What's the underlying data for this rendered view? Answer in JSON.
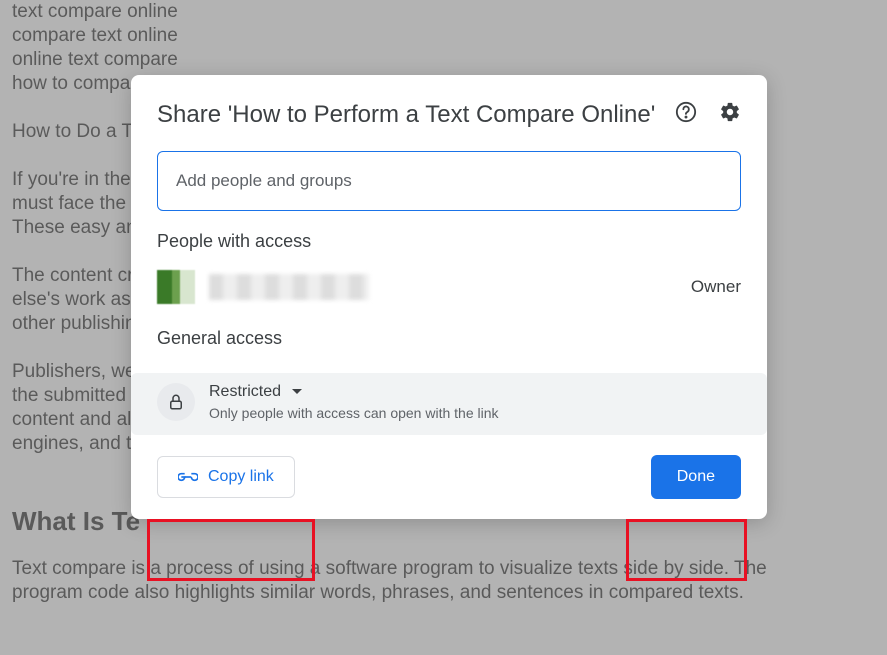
{
  "document": {
    "lines": [
      "text compare online",
      "compare text online",
      "online text compare",
      "how to compa"
    ],
    "para2": "How to Do a T",
    "para3": "If you're in the",
    "para3b": "must face the ",
    "para3c": "These easy an",
    "para4": "The content cr",
    "para4b": "else's work as",
    "para4c": "other publishin",
    "para5": "Publishers, we",
    "para5b": "the submitted ",
    "para5c": "content and al",
    "para5d": "engines, and t",
    "heading": "What Is Te",
    "para6": "Text compare is a process of using a software program to visualize texts side by side. The",
    "para6b": "program code also highlights similar words, phrases, and sentences in compared texts."
  },
  "dialog": {
    "title": "Share 'How to Perform a Text Compare Online'",
    "input_placeholder": "Add people and groups",
    "section_people": "People with access",
    "owner_label": "Owner",
    "section_general": "General access",
    "access_level": "Restricted",
    "access_desc": "Only people with access can open with the link",
    "copy_link": "Copy link",
    "done": "Done"
  }
}
